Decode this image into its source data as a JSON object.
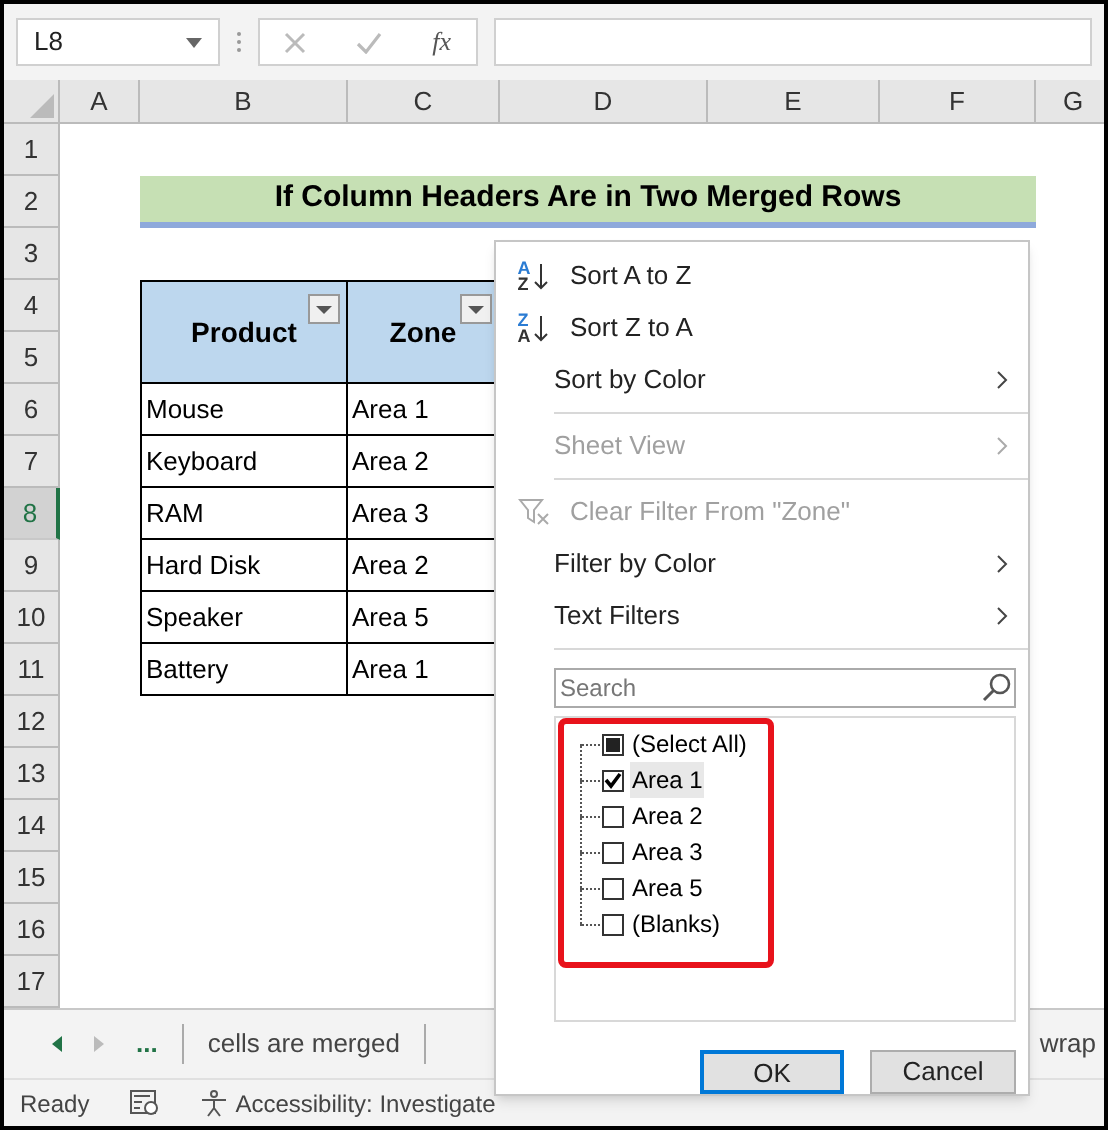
{
  "name_box": "L8",
  "formula_bar": {
    "function_label": "fx"
  },
  "columns": [
    "A",
    "B",
    "C",
    "D",
    "E",
    "F",
    "G"
  ],
  "rows": [
    {
      "label": "1",
      "selected": false
    },
    {
      "label": "2",
      "selected": false
    },
    {
      "label": "3",
      "selected": false
    },
    {
      "label": "4",
      "selected": false
    },
    {
      "label": "5",
      "selected": false
    },
    {
      "label": "6",
      "selected": false
    },
    {
      "label": "7",
      "selected": false
    },
    {
      "label": "8",
      "selected": true
    },
    {
      "label": "9",
      "selected": false
    },
    {
      "label": "10",
      "selected": false
    },
    {
      "label": "11",
      "selected": false
    },
    {
      "label": "12",
      "selected": false
    },
    {
      "label": "13",
      "selected": false
    },
    {
      "label": "14",
      "selected": false
    },
    {
      "label": "15",
      "selected": false
    },
    {
      "label": "16",
      "selected": false
    },
    {
      "label": "17",
      "selected": false
    }
  ],
  "title": "If Column Headers Are in Two Merged Rows",
  "table": {
    "columns": [
      "Product",
      "Zone"
    ],
    "rows": [
      [
        "Mouse",
        "Area 1"
      ],
      [
        "Keyboard",
        "Area 2"
      ],
      [
        "RAM",
        "Area 3"
      ],
      [
        "Hard Disk",
        "Area 2"
      ],
      [
        "Speaker",
        "Area 5"
      ],
      [
        "Battery",
        "Area 1"
      ]
    ]
  },
  "filter_menu": {
    "items": [
      {
        "kind": "sort",
        "icon_letters": [
          "A",
          "Z"
        ],
        "label": "Sort A to Z",
        "disabled": false
      },
      {
        "kind": "sort",
        "icon_letters": [
          "Z",
          "A"
        ],
        "label": "Sort Z to A",
        "disabled": false
      },
      {
        "kind": "submenu",
        "label": "Sort by Color",
        "disabled": false
      },
      {
        "kind": "divider"
      },
      {
        "kind": "submenu",
        "label": "Sheet View",
        "disabled": true
      },
      {
        "kind": "divider"
      },
      {
        "kind": "clear",
        "label": "Clear Filter From \"Zone\"",
        "disabled": true
      },
      {
        "kind": "submenu",
        "label": "Filter by Color",
        "disabled": false
      },
      {
        "kind": "submenu",
        "label": "Text Filters",
        "disabled": false
      },
      {
        "kind": "divider"
      }
    ],
    "search": {
      "placeholder": "Search"
    },
    "values": [
      {
        "label": "(Select All)",
        "checked": false,
        "partial": true,
        "selected": false
      },
      {
        "label": "Area 1",
        "checked": true,
        "selected": true
      },
      {
        "label": "Area 2",
        "checked": false,
        "selected": false
      },
      {
        "label": "Area 3",
        "checked": false,
        "selected": false
      },
      {
        "label": "Area 5",
        "checked": false,
        "selected": false
      },
      {
        "label": "(Blanks)",
        "checked": false,
        "selected": false
      }
    ],
    "buttons": [
      {
        "label": "OK",
        "default": true
      },
      {
        "label": "Cancel",
        "default": false
      }
    ]
  },
  "sheet_tabs": [
    "...",
    "cells are merged",
    "wrap"
  ],
  "status_bar": {
    "text": "Ready",
    "accessibility": "Accessibility: Investigate"
  }
}
